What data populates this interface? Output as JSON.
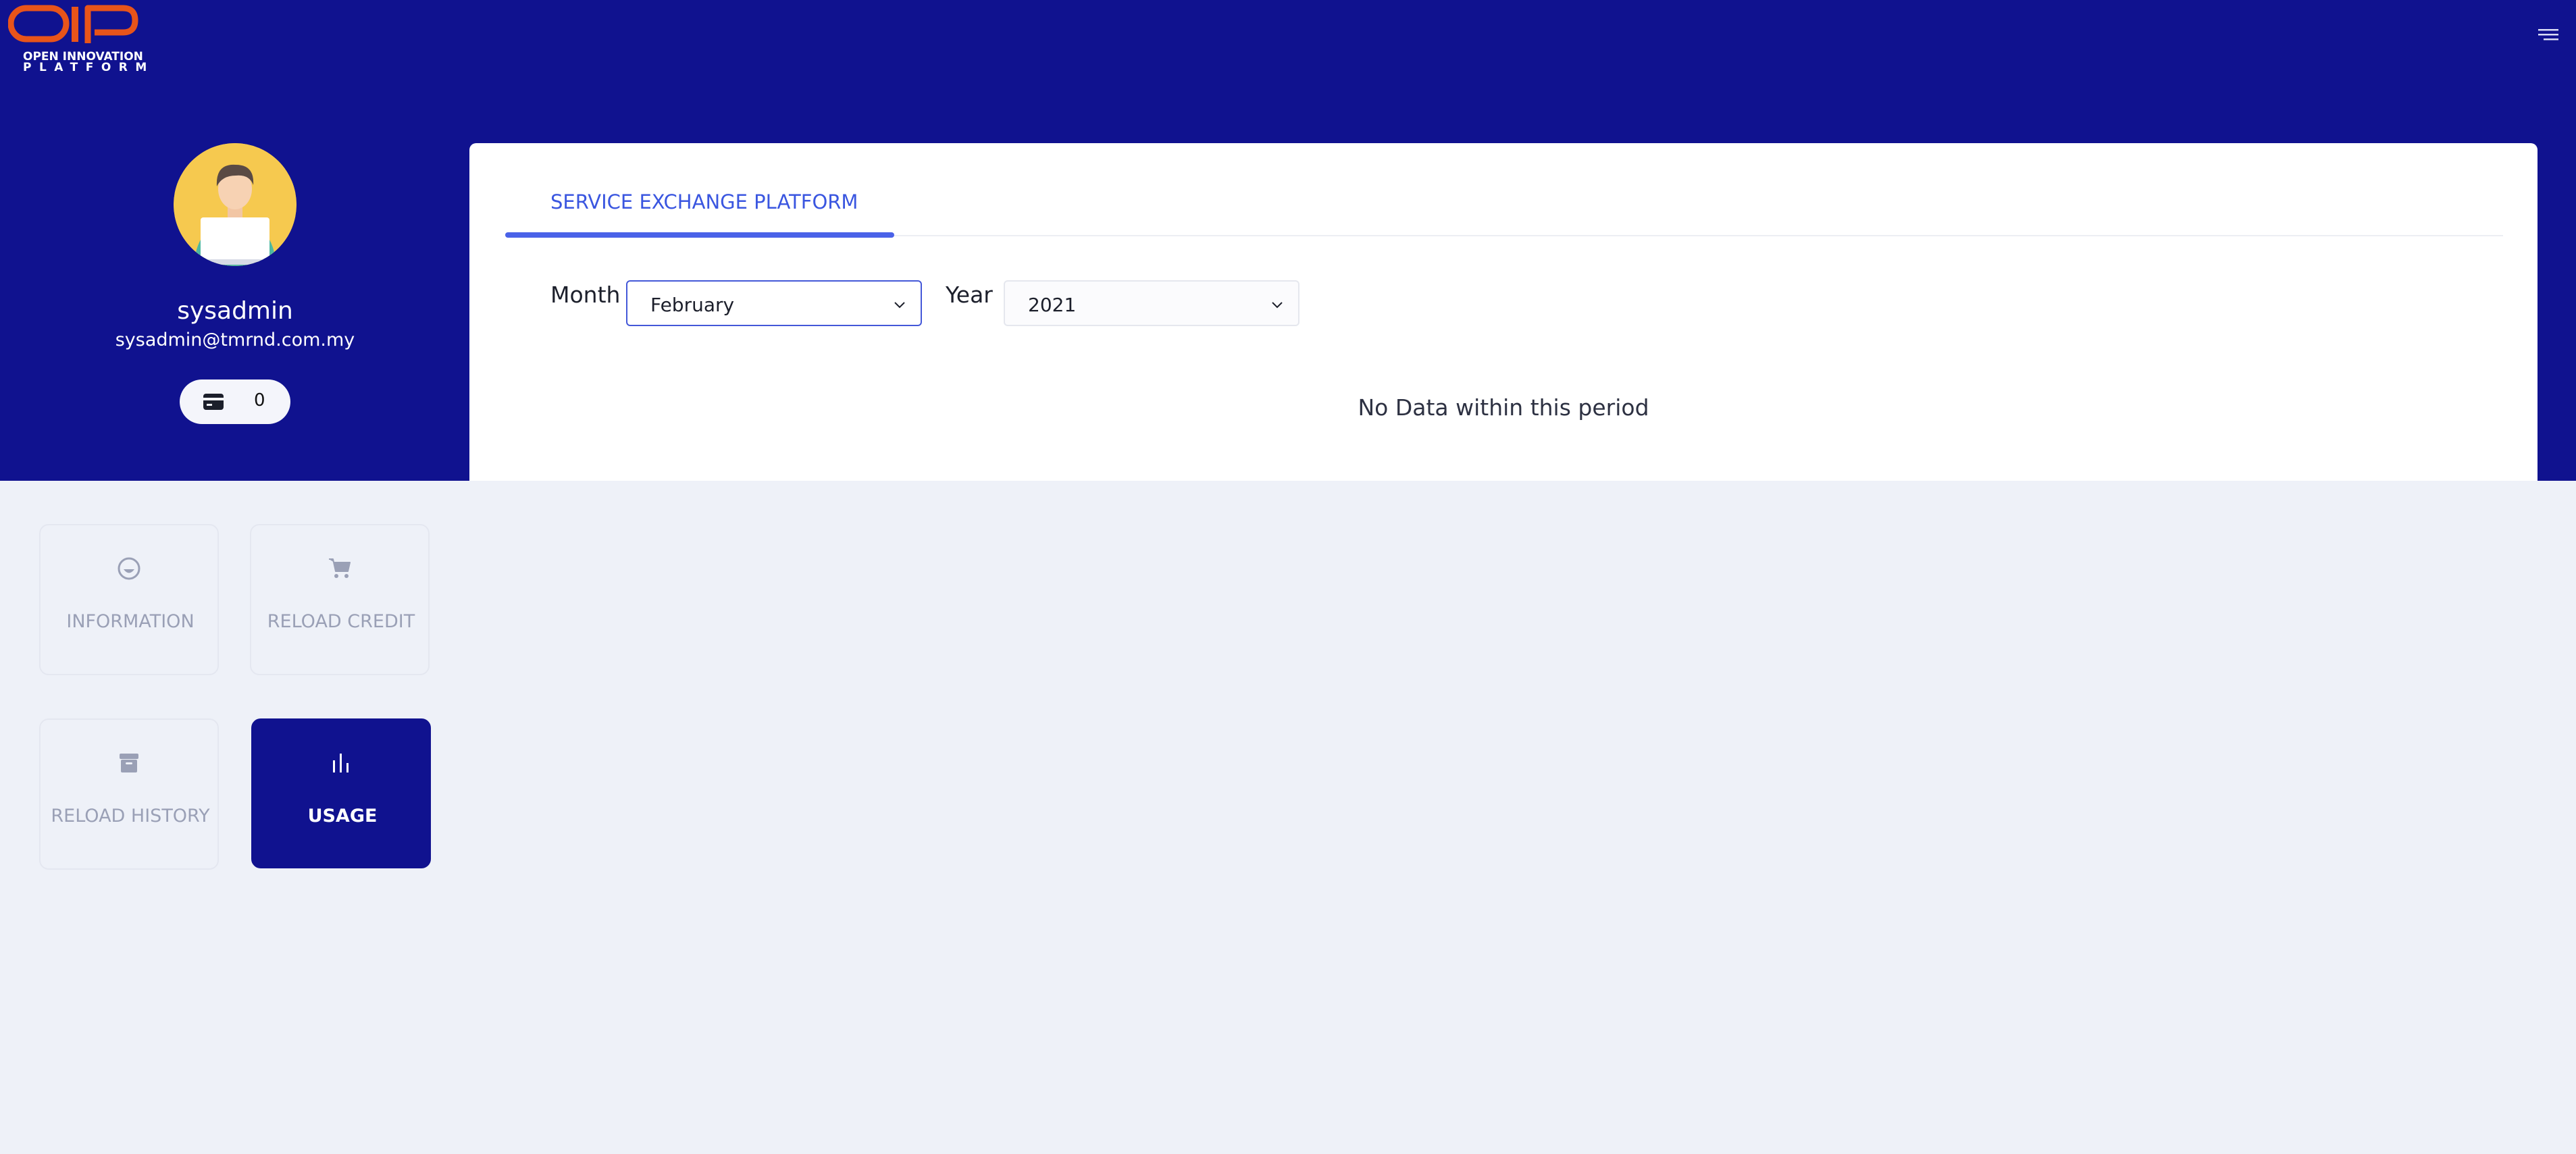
{
  "header": {
    "logo": {
      "line1": "OPEN INNOVATION",
      "line2": "PLATFORM",
      "brand_color": "#e8541a"
    },
    "menu_icon": "hamburger-menu-icon",
    "background": "#10128f"
  },
  "profile": {
    "username": "sysadmin",
    "email": "sysadmin@tmrnd.com.my",
    "credit": "0",
    "credit_icon": "credit-card-icon"
  },
  "main": {
    "tab_label": "SERVICE EXCHANGE PLATFORM",
    "month_label": "Month",
    "month_value": "February",
    "year_label": "Year",
    "year_value": "2021",
    "empty_message": "No Data within this period"
  },
  "nav": {
    "items": [
      {
        "label": "INFORMATION",
        "icon": "smile-icon",
        "active": false
      },
      {
        "label": "RELOAD CREDIT",
        "icon": "cart-icon",
        "active": false
      },
      {
        "label": "RELOAD HISTORY",
        "icon": "archive-icon",
        "active": false
      },
      {
        "label": "USAGE",
        "icon": "bar-chart-icon",
        "active": true
      }
    ]
  },
  "colors": {
    "primary": "#10128f",
    "accent": "#4a62e8",
    "page_bg": "#eef1f8"
  }
}
